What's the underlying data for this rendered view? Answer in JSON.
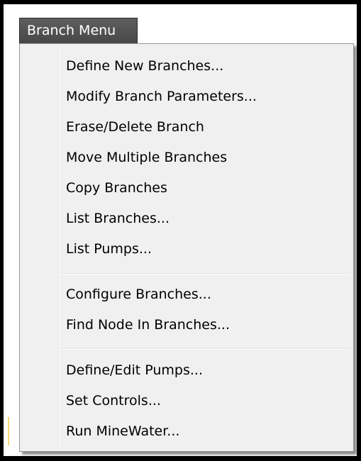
{
  "menu": {
    "title": "Branch Menu",
    "groups": [
      {
        "items": [
          {
            "label": "Define New Branches..."
          },
          {
            "label": "Modify Branch Parameters..."
          },
          {
            "label": "Erase/Delete Branch"
          },
          {
            "label": "Move Multiple Branches"
          },
          {
            "label": "Copy Branches"
          },
          {
            "label": "List Branches..."
          },
          {
            "label": "List Pumps..."
          }
        ]
      },
      {
        "items": [
          {
            "label": "Configure Branches..."
          },
          {
            "label": "Find Node In Branches..."
          }
        ]
      },
      {
        "items": [
          {
            "label": "Define/Edit Pumps..."
          },
          {
            "label": "Set Controls..."
          },
          {
            "label": "Run MineWater..."
          }
        ]
      }
    ]
  },
  "colors": {
    "title_bar": "#4f4f4f",
    "menu_background": "#f0f0f0",
    "frame_border": "#000000"
  }
}
